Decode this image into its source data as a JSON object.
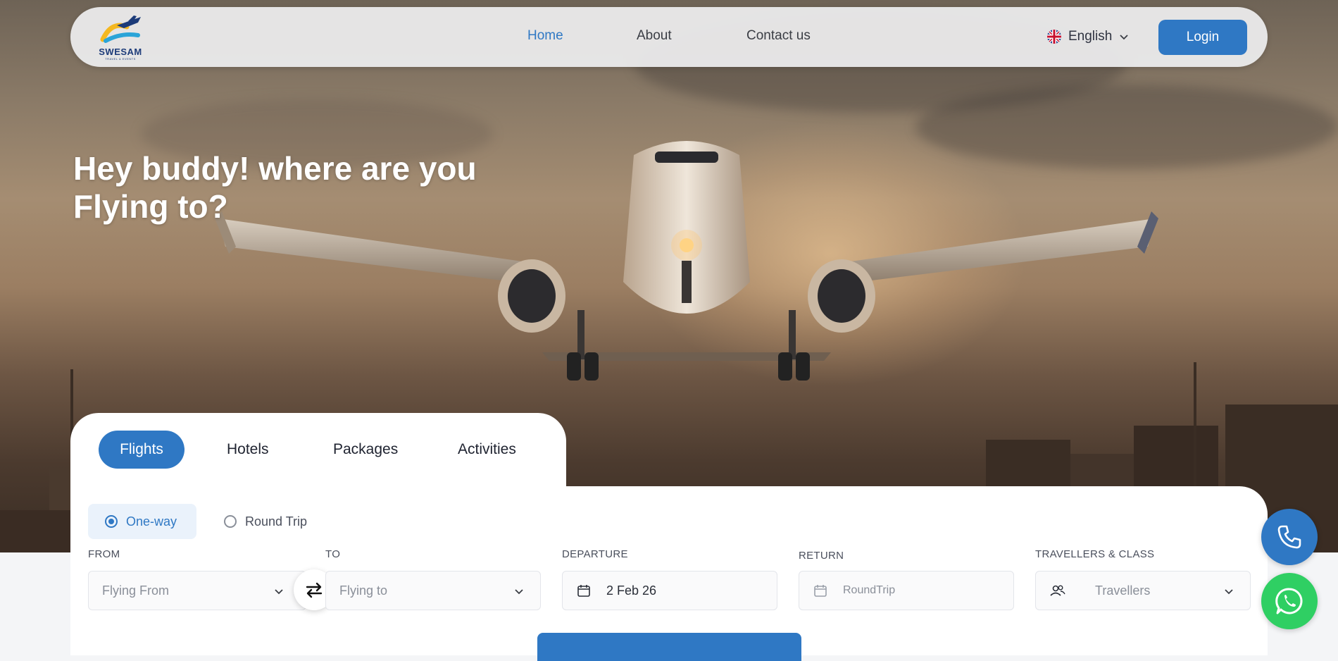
{
  "brand": {
    "name": "SWESAM",
    "tagline": "TRAVEL & EVENTS"
  },
  "nav": {
    "links": [
      {
        "label": "Home",
        "active": true
      },
      {
        "label": "About",
        "active": false
      },
      {
        "label": "Contact us",
        "active": false
      }
    ],
    "language": "English",
    "login": "Login"
  },
  "hero": {
    "line1": "Hey buddy! where are you",
    "line2": "Flying to?"
  },
  "search": {
    "tabs": [
      {
        "label": "Flights",
        "active": true
      },
      {
        "label": "Hotels",
        "active": false
      },
      {
        "label": "Packages",
        "active": false
      },
      {
        "label": "Activities",
        "active": false
      }
    ],
    "trip_types": [
      {
        "label": "One-way",
        "selected": true
      },
      {
        "label": "Round Trip",
        "selected": false
      }
    ],
    "fields": {
      "from": {
        "label": "FROM",
        "placeholder": "Flying From"
      },
      "to": {
        "label": "TO",
        "placeholder": "Flying to"
      },
      "departure": {
        "label": "DEPARTURE",
        "value": "2 Feb 26"
      },
      "return": {
        "label": "RETURN",
        "placeholder": "RoundTrip"
      },
      "travellers": {
        "label": "TRAVELLERS & CLASS",
        "placeholder": "Travellers"
      }
    }
  },
  "colors": {
    "accent": "#2f78c4",
    "whatsapp": "#2fcf63"
  },
  "icons": [
    "flag-uk-icon",
    "chevron-down-icon",
    "swap-icon",
    "calendar-icon",
    "users-icon",
    "phone-icon",
    "whatsapp-icon"
  ]
}
